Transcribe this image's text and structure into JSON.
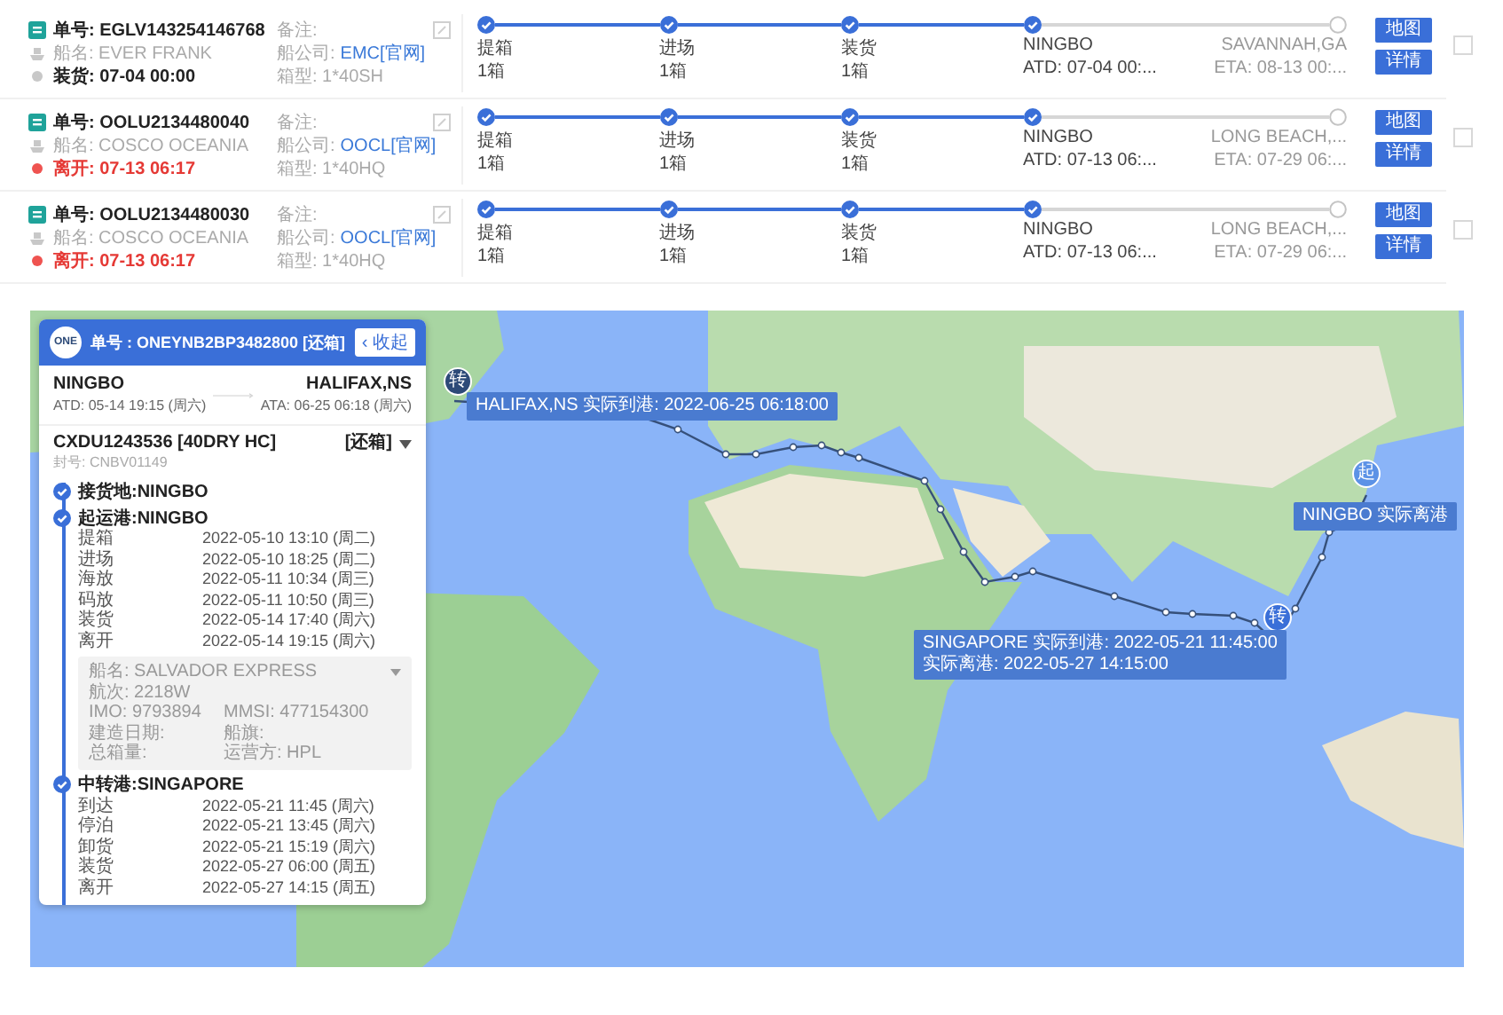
{
  "shipments": [
    {
      "number": "单号: EGLV143254146768",
      "ship": "船名: EVER FRANK",
      "status": {
        "kind": "normal",
        "text": "装货: 07-04 00:00"
      },
      "remark": "备注:",
      "company_label": "船公司:",
      "company": "EMC[官网]",
      "box": "箱型: 1*40SH",
      "steps": [
        {
          "label": "提箱",
          "detail": "1箱",
          "done": true
        },
        {
          "label": "进场",
          "detail": "1箱",
          "done": true
        },
        {
          "label": "装货",
          "detail": "1箱",
          "done": true
        },
        {
          "label": "NINGBO",
          "detail": "ATD: 07-04 00:...",
          "done": true
        },
        {
          "label": "SAVANNAH,GA",
          "detail": "ETA: 08-13 00:...",
          "done": false
        }
      ],
      "buttons": [
        "地图",
        "详情"
      ],
      "checked": false
    },
    {
      "number": "单号: OOLU2134480040",
      "ship": "船名: COSCO OCEANIA",
      "status": {
        "kind": "alert",
        "text": "离开: 07-13 06:17"
      },
      "remark": "备注:",
      "company_label": "船公司:",
      "company": "OOCL[官网]",
      "box": "箱型: 1*40HQ",
      "steps": [
        {
          "label": "提箱",
          "detail": "1箱",
          "done": true
        },
        {
          "label": "进场",
          "detail": "1箱",
          "done": true
        },
        {
          "label": "装货",
          "detail": "1箱",
          "done": true
        },
        {
          "label": "NINGBO",
          "detail": "ATD: 07-13 06:...",
          "done": true
        },
        {
          "label": "LONG BEACH,...",
          "detail": "ETA: 07-29 06:...",
          "done": false
        }
      ],
      "buttons": [
        "地图",
        "详情"
      ],
      "checked": false
    },
    {
      "number": "单号: OOLU2134480030",
      "ship": "船名: COSCO OCEANIA",
      "status": {
        "kind": "alert",
        "text": "离开: 07-13 06:17"
      },
      "remark": "备注:",
      "company_label": "船公司:",
      "company": "OOCL[官网]",
      "box": "箱型: 1*40HQ",
      "steps": [
        {
          "label": "提箱",
          "detail": "1箱",
          "done": true
        },
        {
          "label": "进场",
          "detail": "1箱",
          "done": true
        },
        {
          "label": "装货",
          "detail": "1箱",
          "done": true
        },
        {
          "label": "NINGBO",
          "detail": "ATD: 07-13 06:...",
          "done": true
        },
        {
          "label": "LONG BEACH,...",
          "detail": "ETA: 07-29 06:...",
          "done": false
        }
      ],
      "buttons": [
        "地图",
        "详情"
      ],
      "checked": false
    }
  ],
  "map": {
    "markers": [
      {
        "pin": "转",
        "lines": [
          "HALIFAX,NS  实际到港: 2022-06-25 06:18:00"
        ],
        "kind": "end"
      },
      {
        "pin": "转",
        "lines": [
          "SINGAPORE  实际到港: 2022-05-21 11:45:00",
          "实际离港: 2022-05-27 14:15:00"
        ],
        "kind": "transit"
      },
      {
        "pin": "起",
        "lines": [
          "NINGBO  实际离港"
        ],
        "kind": "start"
      }
    ],
    "panel": {
      "logo": "ONE",
      "title": "单号 : ONEYNB2BP3482800 [还箱]",
      "collapse": "‹ 收起",
      "origin": {
        "port": "NINGBO",
        "time": "ATD: 05-14 19:15 (周六)"
      },
      "destination": {
        "port": "HALIFAX,NS",
        "time": "ATA: 06-25 06:18 (周六)"
      },
      "container": "CXDU1243536 [40DRY HC]",
      "container_status": "[还箱]",
      "seal": "封号: CNBV01149",
      "groups": [
        {
          "title": "接货地:NINGBO"
        },
        {
          "title": "起运港:NINGBO",
          "events": [
            {
              "name": "提箱",
              "time": "2022-05-10 13:10 (周二)"
            },
            {
              "name": "进场",
              "time": "2022-05-10 18:25 (周二)"
            },
            {
              "name": "海放",
              "time": "2022-05-11 10:34 (周三)"
            },
            {
              "name": "码放",
              "time": "2022-05-11 10:50 (周三)"
            },
            {
              "name": "装货",
              "time": "2022-05-14 17:40 (周六)"
            },
            {
              "name": "离开",
              "time": "2022-05-14 19:15 (周六)"
            }
          ],
          "vessel": [
            [
              "船名: SALVADOR EXPRESS"
            ],
            [
              "航次: 2218W"
            ],
            [
              "IMO: 9793894",
              "MMSI: 477154300"
            ],
            [
              "建造日期:",
              "船旗:"
            ],
            [
              "总箱量:",
              "运营方: HPL"
            ]
          ]
        },
        {
          "title": "中转港:SINGAPORE",
          "events": [
            {
              "name": "到达",
              "time": "2022-05-21 11:45 (周六)"
            },
            {
              "name": "停泊",
              "time": "2022-05-21 13:45 (周六)"
            },
            {
              "name": "卸货",
              "time": "2022-05-21 15:19 (周六)"
            },
            {
              "name": "装货",
              "time": "2022-05-27 06:00 (周五)"
            },
            {
              "name": "离开",
              "time": "2022-05-27 14:15 (周五)"
            }
          ]
        }
      ]
    }
  }
}
